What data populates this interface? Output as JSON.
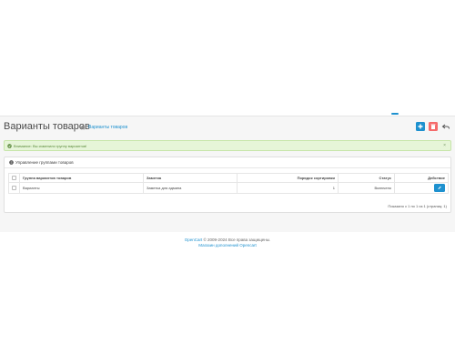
{
  "page": {
    "title": "Варианты товаров",
    "breadcrumb_home_icon": "home-icon",
    "breadcrumb_current": "Варианты товаров",
    "actions": {
      "add_icon": "plus-icon",
      "delete_icon": "trash-icon",
      "back_icon": "reply-icon"
    }
  },
  "alert": {
    "icon": "check-circle-icon",
    "text": "Внимание: Вы изменили группу вариантов!",
    "close": "×"
  },
  "panel": {
    "icon": "list-icon",
    "title": "Управление группами товаров"
  },
  "table": {
    "headers": [
      "Группа вариантов товаров",
      "Заметка",
      "Порядок сортировки",
      "Статус",
      "Действие"
    ],
    "rows": [
      {
        "group": "Варианты",
        "note": "Заметка для админа",
        "sort": "1",
        "status": "Включено",
        "action_icon": "pencil-icon"
      }
    ]
  },
  "pagination": "Показано с 1 по 1 из 1 (страниц: 1)",
  "footer": {
    "brand": "OpenCart",
    "copyright": " © 2009-2024 Все права защищены.",
    "link": "Магазин дополнений Opencart"
  },
  "colors": {
    "primary": "#1e91cf",
    "danger": "#f56b6b",
    "success_bg": "#e6f5d8",
    "success_text": "#5a8a3a"
  }
}
